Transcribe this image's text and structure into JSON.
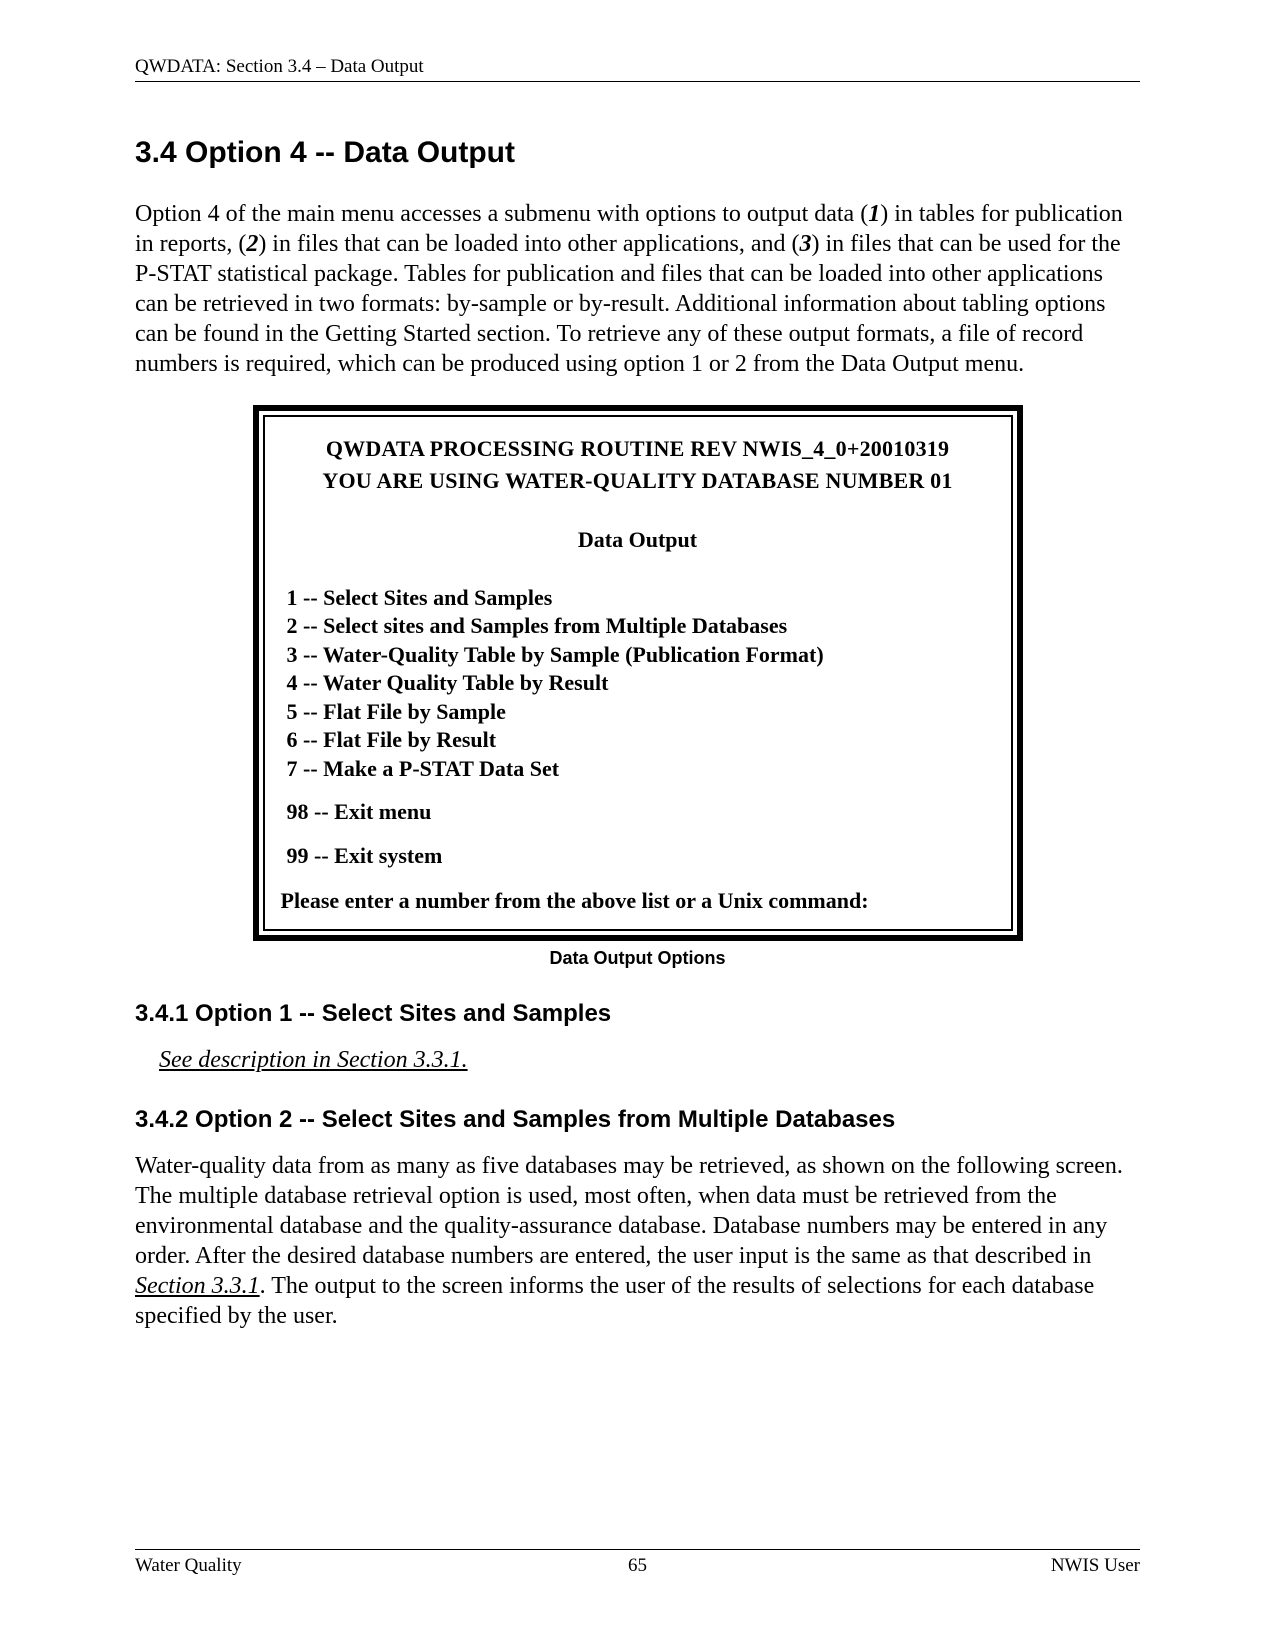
{
  "header": {
    "running_head": "QWDATA:  Section 3.4 – Data Output"
  },
  "section": {
    "title": "3.4 Option 4 -- Data Output",
    "intro_pre": "Option 4 of the main menu accesses a submenu with options to output data (",
    "b1": "1",
    "intro_mid1": ") in tables for publication in reports, (",
    "b2": "2",
    "intro_mid2": ") in files that can be loaded into other applications, and (",
    "b3": "3",
    "intro_post": ") in files that can be used for the P-STAT statistical package. Tables for publication and files that can be loaded into other applications can be retrieved in two formats: by-sample or by-result. Additional information about tabling options can be found in the Getting Started section. To retrieve any of these output formats, a file of record numbers is required, which can be produced using option 1 or 2 from the Data Output menu."
  },
  "menu": {
    "line1": "QWDATA PROCESSING ROUTINE   REV NWIS_4_0+20010319",
    "line2": "YOU ARE USING WATER-QUALITY DATABASE NUMBER 01",
    "title": "Data Output",
    "items": [
      " 1 -- Select Sites and Samples",
      " 2 -- Select sites and Samples from Multiple Databases",
      " 3 -- Water-Quality Table by Sample (Publication Format)",
      " 4 -- Water Quality Table by Result",
      " 5 -- Flat File by Sample",
      " 6 -- Flat File by Result",
      " 7 -- Make a P-STAT Data Set"
    ],
    "item98": "98 -- Exit menu",
    "item99": "99 -- Exit system",
    "prompt": "Please enter a number from the above list or a Unix command:",
    "caption": "Data Output Options"
  },
  "sub1": {
    "title": "3.4.1 Option 1 -- Select Sites and Samples",
    "see": "See description in Section 3.3.1."
  },
  "sub2": {
    "title": "3.4.2 Option 2 -- Select Sites and Samples from Multiple Databases",
    "para_pre": "Water-quality data from as many as five databases may be retrieved, as shown on the following screen. The multiple database retrieval option is used, most often, when data must be retrieved from the environmental database and the quality-assurance database. Database numbers may be entered in any order. After the desired database numbers are entered, the user input is the same as that described in ",
    "xref": "Section 3.3.1",
    "para_post": ". The output to the screen informs the user of the results of selections for each database specified by the user."
  },
  "footer": {
    "left": "Water Quality",
    "center": "65",
    "right": "NWIS User"
  }
}
